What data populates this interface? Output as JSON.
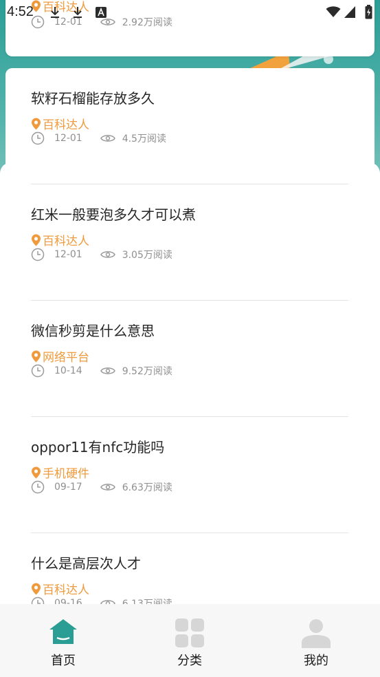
{
  "status_bar": {
    "time": "4:52",
    "notification_icons": [
      "download-icon",
      "download-icon",
      "a-box-icon"
    ],
    "system_icons": [
      "wifi-icon",
      "signal-icon",
      "battery-icon"
    ]
  },
  "accent": "#2a9e95",
  "category_color": "#ef9a3c",
  "top_card": {
    "category": "百科达人",
    "date": "12-01",
    "reads": "2.92万阅读"
  },
  "articles": [
    {
      "title": "软籽石榴能存放多久",
      "category": "百科达人",
      "date": "12-01",
      "reads": "4.5万阅读"
    },
    {
      "title": "红米一般要泡多久才可以煮",
      "category": "百科达人",
      "date": "12-01",
      "reads": "3.05万阅读"
    },
    {
      "title": "微信秒剪是什么意思",
      "category": "网络平台",
      "date": "10-14",
      "reads": "9.52万阅读"
    },
    {
      "title": "oppor11有nfc功能吗",
      "category": "手机硬件",
      "date": "09-17",
      "reads": "6.63万阅读"
    },
    {
      "title": "什么是高层次人才",
      "category": "百科达人",
      "date": "09-16",
      "reads": "6.13万阅读"
    }
  ],
  "tab_bar": {
    "tabs": [
      {
        "label": "首页",
        "icon": "home-icon",
        "active": true
      },
      {
        "label": "分类",
        "icon": "grid-icon",
        "active": false
      },
      {
        "label": "我的",
        "icon": "user-icon",
        "active": false
      }
    ]
  }
}
